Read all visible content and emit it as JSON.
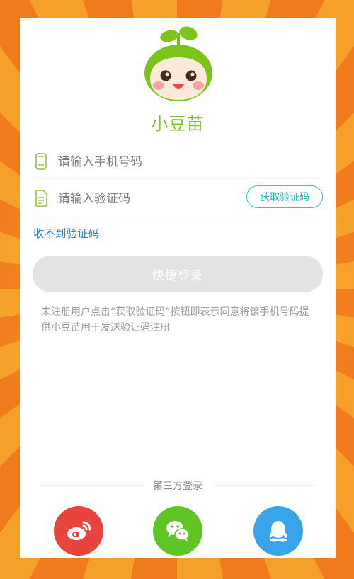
{
  "app": {
    "name": "小豆苗"
  },
  "login": {
    "phone_placeholder": "请输入手机号码",
    "code_placeholder": "请输入验证码",
    "get_code_label": "获取验证码",
    "no_code_link": "收不到验证码",
    "submit_label": "快捷登录",
    "notice": "未注册用户点击“获取验证码”按钮即表示同意将该手机号码提供小豆苗用于发送验证码注册"
  },
  "third_party": {
    "title": "第三方登录",
    "providers": [
      "weibo-icon",
      "wechat-icon",
      "qq-icon"
    ]
  },
  "colors": {
    "brand": "#7cc41c",
    "accent_teal": "#39c6c0",
    "link_blue": "#3a86c8",
    "weibo": "#e8443e",
    "wechat": "#5ec525",
    "qq": "#3aa4ea"
  }
}
